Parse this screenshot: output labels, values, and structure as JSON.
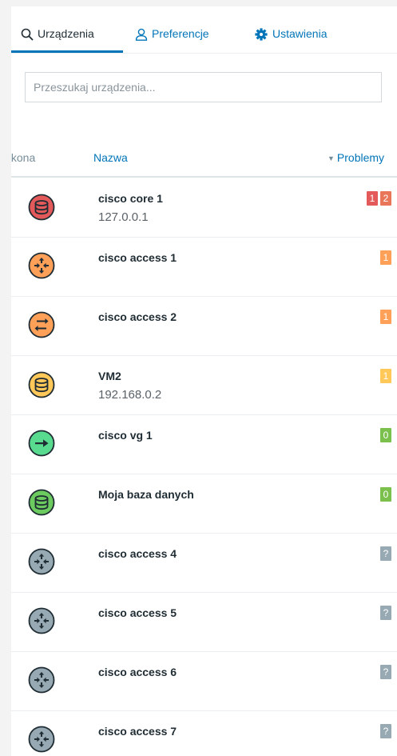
{
  "tabs": [
    {
      "label": "Urządzenia",
      "icon": "search-icon"
    },
    {
      "label": "Preferencje",
      "icon": "user-icon"
    },
    {
      "label": "Ustawienia",
      "icon": "gear-icon"
    }
  ],
  "search": {
    "placeholder": "Przeszukaj urządzenia..."
  },
  "table": {
    "headers": {
      "icon": "Ikona",
      "name": "Nazwa",
      "problems": "Problemy",
      "sort_indicator": "▼"
    },
    "rows": [
      {
        "name": "cisco core 1",
        "ip": "127.0.0.1",
        "icon": "database-icon",
        "color": "#e45959",
        "badges": [
          {
            "text": "1",
            "color": "#e45959"
          },
          {
            "text": "2",
            "color": "#e97659"
          }
        ]
      },
      {
        "name": "cisco access 1",
        "ip": "",
        "icon": "router-icon",
        "color": "#ffa059",
        "badges": [
          {
            "text": "1",
            "color": "#ffa059"
          }
        ]
      },
      {
        "name": "cisco access 2",
        "ip": "",
        "icon": "switch-icon",
        "color": "#ffa059",
        "badges": [
          {
            "text": "1",
            "color": "#ffa059"
          }
        ]
      },
      {
        "name": "VM2",
        "ip": "192.168.0.2",
        "icon": "database-icon",
        "color": "#ffc859",
        "badges": [
          {
            "text": "1",
            "color": "#ffc859"
          }
        ]
      },
      {
        "name": "cisco vg 1",
        "ip": "",
        "icon": "arrow-right-icon",
        "color": "#59db8f",
        "badges": [
          {
            "text": "0",
            "color": "#7bc04c"
          }
        ]
      },
      {
        "name": "Moja baza danych",
        "ip": "",
        "icon": "database-icon",
        "color": "#6ccb5f",
        "badges": [
          {
            "text": "0",
            "color": "#7bc04c"
          }
        ]
      },
      {
        "name": "cisco access 4",
        "ip": "",
        "icon": "router-icon",
        "color": "#97aab3",
        "badges": [
          {
            "text": "?",
            "color": "#97aab3"
          }
        ]
      },
      {
        "name": "cisco access 5",
        "ip": "",
        "icon": "router-icon",
        "color": "#97aab3",
        "badges": [
          {
            "text": "?",
            "color": "#97aab3"
          }
        ]
      },
      {
        "name": "cisco access 6",
        "ip": "",
        "icon": "router-icon",
        "color": "#97aab3",
        "badges": [
          {
            "text": "?",
            "color": "#97aab3"
          }
        ]
      },
      {
        "name": "cisco access 7",
        "ip": "",
        "icon": "router-icon",
        "color": "#97aab3",
        "badges": [
          {
            "text": "?",
            "color": "#97aab3"
          }
        ]
      }
    ]
  }
}
